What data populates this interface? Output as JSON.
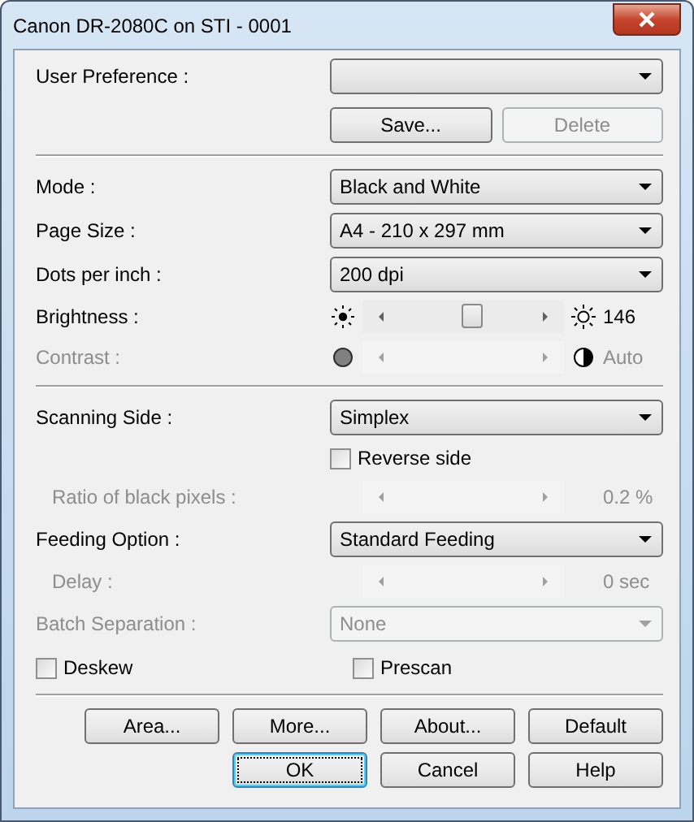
{
  "window": {
    "title": "Canon DR-2080C on STI - 0001"
  },
  "user_preference": {
    "label": "User Preference :",
    "buttons": [
      {
        "label": "Save...",
        "disabled": false
      },
      {
        "label": "Delete",
        "disabled": true
      }
    ]
  },
  "sections": [
    {
      "rows": [
        {
          "kind": "dropdown",
          "label": "Mode :",
          "value": "Black and White",
          "disabled": false
        },
        {
          "kind": "dropdown",
          "label": "Page Size :",
          "value": "A4 - 210 x 297 mm",
          "disabled": false
        },
        {
          "kind": "dropdown",
          "label": "Dots per inch :",
          "value": "200 dpi",
          "disabled": false
        },
        {
          "kind": "sun_slider",
          "label": "Brightness :",
          "level": 0.57,
          "reading": "146",
          "disabled": false,
          "indented": false
        },
        {
          "kind": "contrast_slider",
          "label": "Contrast :",
          "reading": "Auto",
          "disabled": true,
          "indented": false
        }
      ]
    },
    {
      "rows": [
        {
          "kind": "dropdown",
          "label": "Scanning Side :",
          "value": "Simplex",
          "disabled": false
        },
        {
          "kind": "checkbox",
          "label": "Reverse side",
          "checked": false
        },
        {
          "kind": "slider",
          "label": "Ratio of black pixels :",
          "reading": "0.2 %",
          "disabled": true,
          "indented": true
        },
        {
          "kind": "dropdown",
          "label": "Feeding Option :",
          "value": "Standard Feeding",
          "disabled": false
        },
        {
          "kind": "slider",
          "label": "Delay :",
          "reading": "0 sec",
          "disabled": true,
          "indented": true
        },
        {
          "kind": "dropdown",
          "label": "Batch Separation :",
          "value": "None",
          "disabled": true
        }
      ],
      "options": [
        {
          "label": "Deskew",
          "checked": false
        },
        {
          "label": "Prescan",
          "checked": false
        }
      ]
    }
  ],
  "button_rows": [
    [
      {
        "label": "Area...",
        "default": false
      },
      {
        "label": "More...",
        "default": false
      },
      {
        "label": "About...",
        "default": false
      },
      {
        "label": "Default",
        "default": false
      }
    ],
    [
      {
        "label": "OK",
        "default": true
      },
      {
        "label": "Cancel",
        "default": false
      },
      {
        "label": "Help",
        "default": false
      }
    ]
  ]
}
